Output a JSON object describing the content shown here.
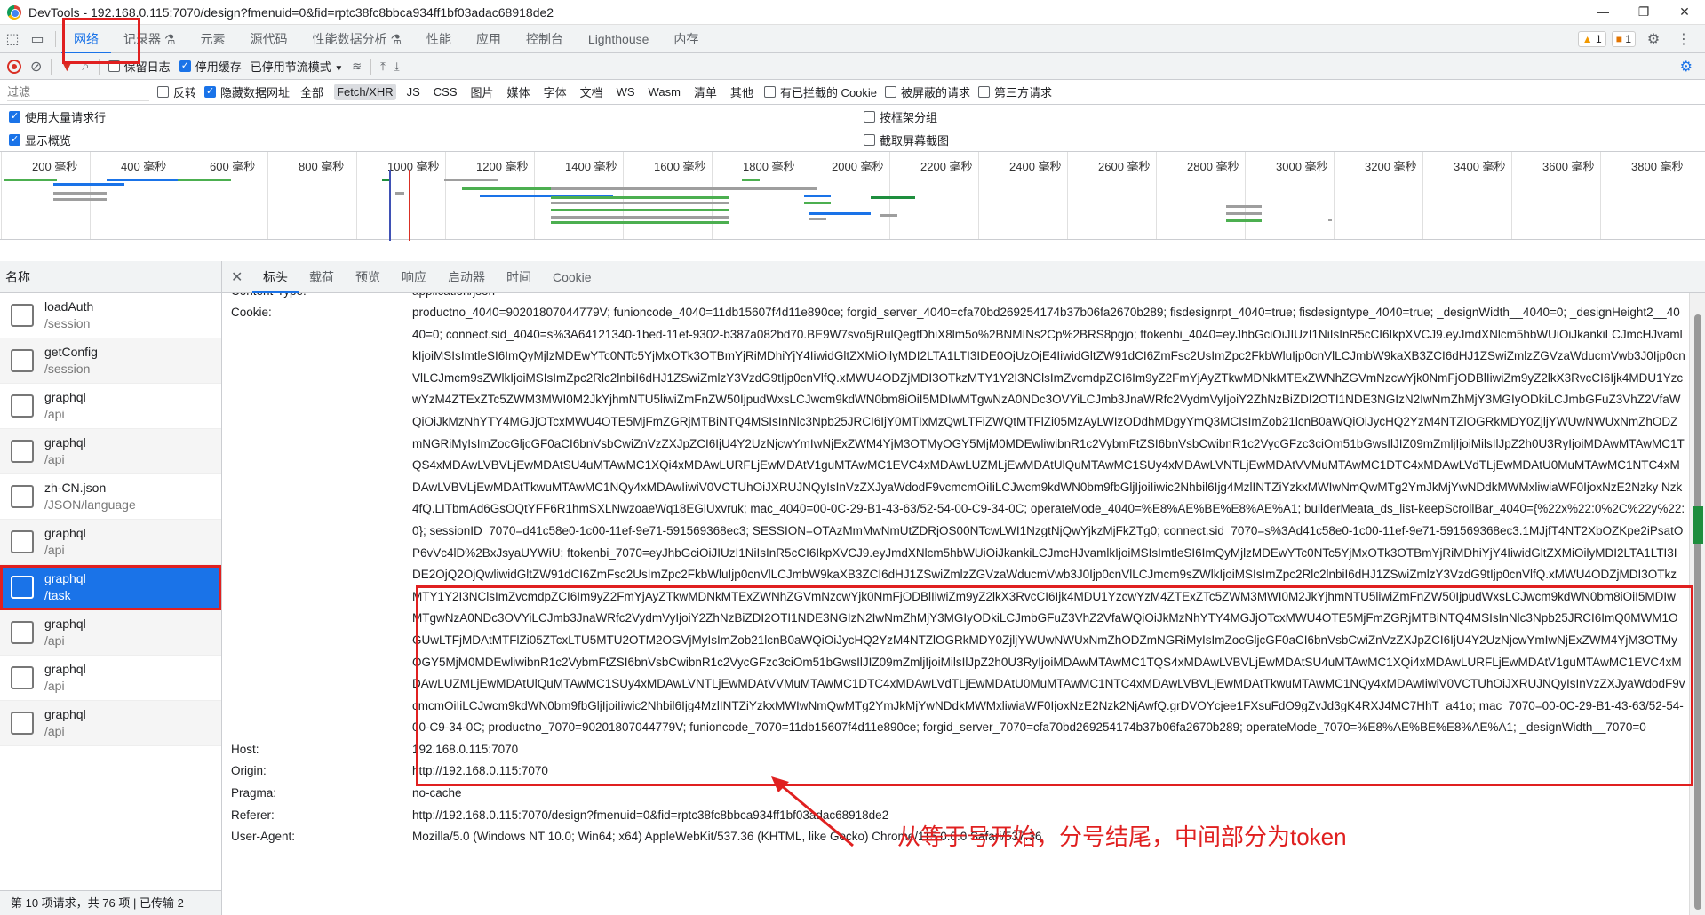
{
  "window": {
    "title": "DevTools - 192.168.0.115:7070/design?fmenuid=0&fid=rptc38fc8bbca934ff1bf03adac68918de2",
    "controls": [
      "—",
      "❐",
      "✕"
    ]
  },
  "tabs": [
    "网络",
    "记录器 ⚗",
    "元素",
    "源代码",
    "性能数据分析 ⚗",
    "性能",
    "应用",
    "控制台",
    "Lighthouse",
    "内存"
  ],
  "issues": {
    "warnings": "1",
    "info": "1"
  },
  "toolbar": {
    "preserve_log": "保留日志",
    "disable_cache": "停用缓存",
    "throttle": "已停用节流模式"
  },
  "filter": {
    "placeholder": "过滤",
    "invert": "反转",
    "hide_data_urls": "隐藏数据网址",
    "types": [
      "全部",
      "Fetch/XHR",
      "JS",
      "CSS",
      "图片",
      "媒体",
      "字体",
      "文档",
      "WS",
      "Wasm",
      "清单",
      "其他"
    ],
    "selected_type": "Fetch/XHR",
    "blocked_cookies": "有已拦截的 Cookie",
    "blocked_requests": "被屏蔽的请求",
    "third_party": "第三方请求"
  },
  "options": {
    "large_rows": "使用大量请求行",
    "group_by_frame": "按框架分组",
    "show_overview": "显示概览",
    "capture_screenshots": "截取屏幕截图"
  },
  "timeline": {
    "ticks": [
      "200 毫秒",
      "400 毫秒",
      "600 毫秒",
      "800 毫秒",
      "1000 毫秒",
      "1200 毫秒",
      "1400 毫秒",
      "1600 毫秒",
      "1800 毫秒",
      "2000 毫秒",
      "2200 毫秒",
      "2400 毫秒",
      "2600 毫秒",
      "2800 毫秒",
      "3000 毫秒",
      "3200 毫秒",
      "3400 毫秒",
      "3600 毫秒",
      "3800 毫秒"
    ]
  },
  "requests": {
    "header": "名称",
    "items": [
      {
        "name": "loadAuth",
        "path": "/session"
      },
      {
        "name": "getConfig",
        "path": "/session"
      },
      {
        "name": "graphql",
        "path": "/api"
      },
      {
        "name": "graphql",
        "path": "/api"
      },
      {
        "name": "zh-CN.json",
        "path": "/JSON/language"
      },
      {
        "name": "graphql",
        "path": "/api"
      },
      {
        "name": "graphql",
        "path": "/task"
      },
      {
        "name": "graphql",
        "path": "/api"
      },
      {
        "name": "graphql",
        "path": "/api"
      },
      {
        "name": "graphql",
        "path": "/api"
      }
    ],
    "selected_index": 6,
    "status": "第 10 项请求，共 76 项 | 已传输 2"
  },
  "detail": {
    "tabs": [
      "标头",
      "载荷",
      "预览",
      "响应",
      "启动器",
      "时间",
      "Cookie"
    ],
    "active_tab": "标头",
    "cut_key": "Content-Type:",
    "cut_value": "application/json",
    "cookie_key": "Cookie:",
    "cookie_part1": "productno_4040=90201807044779V; funioncode_4040=11db15607f4d11e890ce; forgid_server_4040=cfa70bd269254174b37b06fa2670b289; fisdesignrpt_4040=true; fisdesigntype_4040=true; _designWidth__4040=0; _designHeight2__4040=0; connect.sid_4040=s%3A64121340-1bed-11ef-9302-b387a082bd70.BE9W7svo5jRulQegfDhiX8lm5o%2BNMINs2Cp%2BRS8pgjo; ftokenbi_4040=eyJhbGciOiJIUzI1NiIsInR5cCI6IkpXVCJ9.eyJmdXNlcm5hbWUiOiJkankiLCJmcHJvamlkIjoiMSIsImtleSI6ImQyMjlzMDEwYTc0NTc5YjMxOTk3OTBmYjRiMDhiYjY4IiwidGltZXMiOilyMDI2LTA1LTI3IDE0OjUzOjE4IiwidGltZW91dCI6ZmFsc2UsImZpc2FkbWluIjp0cnVlLCJmbW9kaXB3ZCI6dHJ1ZSwiZmlzZGVzaWducmVwb3J0Ijp0cnVlLCJmcm9sZWlkIjoiMSIsImZpc2Rlc2lnbiI6dHJ1ZSwiZmlzY3VzdG9tIjp0cnVlfQ.xMWU4ODZjMDI3OTkzMTY1Y2I3NClsImZvcmdpZCI6Im9yZ2FmYjAyZTkwMDNkMTExZWNhZGVmNzcwYjk0NmFjODBlIiwiZm9yZ2lkX3RvcCI6Ijk4MDU1YzcwYzM4ZTExZTc5ZWM3MWI0M2JkYjhmNTU5liwiZmFnZW50IjpudWxsLCJwcm9kdWN0bm8iOiI5MDIwMTgwNzA0NDc3OVYiLCJmb3JnaWRfc2VydmVyIjoiY2ZhNzBiZDI2OTI1NDE3NGIzN2IwNmZhMjY3MGIyODkiLCJmbGFuZ3VhZ2VfaWQiOiJkMzNhYTY4MGJjOTcxMWU4OTE5MjFmZGRjMTBiNTQ4MSIsInNlc3Npb25JRCI6IjY0MTIxMzQwLTFiZWQtMTFlZi05MzAyLWIzODdhMDgyYmQ3MCIsImZob21lcnB0aWQiOiJycHQ2YzM4NTZlOGRkMDY0ZjljYWUwNWUxNmZhODZmNGRiMyIsImZocGljcGF0aCI6bnVsbCwiZnVzZXJpZCI6IjU4Y2UzNjcwYmIwNjExZWM4YjM3OTMyOGY5MjM0MDEwliwibnR1c2VybmFtZSI6bnVsbCwibnR1c2VycGFzc3ciOm51bGwsIlJIZ09mZmljIjoiMilsIlJpZ2h0U3RyIjoiMDAwMTAwMC1TQS4xMDAwLVBVLjEwMDAtSU4uMTAwMC1XQi4xMDAwLURFLjEwMDAtV1guMTAwMC1EVC4xMDAwLUZMLjEwMDAtUlQuMTAwMC1SUy4xMDAwLVNTLjEwMDAtVVMuMTAwMC1DTC4xMDAwLVdTLjEwMDAtU0MuMTAwMC1NTC4xMDAwLVBVLjEwMDAtTkwuMTAwMC1NQy4xMDAwIiwiV0VCTUhOiJXRUJNQyIsInVzZXJyaWdodF9vcmcmOiIiLCJwcm9kdWN0bm9fbGljIjoiIiwic2Nhbil6Ijg4MzlINTZiYzkxMWIwNmQwMTg2YmJkMjYwNDdkMWMxliwiaWF0IjoxNzE2Nzky Nzk4fQ.LITbmAd6GsOQtYFF6R1hmSXLNwzoaeWq18EGlUxvruk; mac_4040=00-0C-29-B1-43-63/52-54-00-C9-34-0C; operateMode_4040=%E8%AE%BE%E8%AE%A1; builderMeata_ds_list-keepScrollBar_4040={%22x%22:0%2C%22y%22:0}; sessionID_7070=d41c58e0-1c00-11ef-9e71-591569368ec3; SESSION=OTAzMmMwNmUtZDRjOS00NTcwLWI1NzgtNjQwYjkzMjFkZTg0; connect.sid_7070=s%3Ad41c58e0-1c00-11ef-9e71-591569368ec3.1MJjfT4NT2XbOZKpe2iPsatOP6vVc4lD%2BxJsyaUYWiU;",
    "cookie_token": "ftokenbi_7070=eyJhbGciOiJIUzI1NiIsInR5cCI6IkpXVCJ9.eyJmdXNlcm5hbWUiOiJkankiLCJmcHJvamlkIjoiMSIsImtleSI6ImQyMjlzMDEwYTc0NTc5YjMxOTk3OTBmYjRiMDhiYjY4IiwidGltZXMiOilyMDI2LTA1LTI3IDE2OjQ2OjQwliwidGltZW91dCI6ZmFsc2UsImZpc2FkbWluIjp0cnVlLCJmbW9kaXB3ZCI6dHJ1ZSwiZmlzZGVzaWducmVwb3J0Ijp0cnVlLCJmcm9sZWlkIjoiMSIsImZpc2Rlc2lnbiI6dHJ1ZSwiZmlzY3VzdG9tIjp0cnVlfQ.xMWU4ODZjMDI3OTkzMTY1Y2I3NClsImZvcmdpZCI6Im9yZ2FmYjAyZTkwMDNkMTExZWNhZGVmNzcwYjk0NmFjODBlIiwiZm9yZ2lkX3RvcCI6Ijk4MDU1YzcwYzM4ZTExZTc5ZWM3MWI0M2JkYjhmNTU5liwiZmFnZW50IjpudWxsLCJwcm9kdWN0bm8iOiI5MDIwMTgwNzA0NDc3OVYiLCJmb3JnaWRfc2VydmVyIjoiY2ZhNzBiZDI2OTI1NDE3NGIzN2IwNmZhMjY3MGIyODkiLCJmbGFuZ3VhZ2VfaWQiOiJkMzNhYTY4MGJjOTcxMWU4OTE5MjFmZGRjMTBiNTQ4MSIsInNlc3Npb25JRCI6ImQ0MWM1OGUwLTFjMDAtMTFlZi05ZTcxLTU5MTU2OTM2OGVjMyIsImZob21lcnB0aWQiOiJycHQ2YzM4NTZlOGRkMDY0ZjljYWUwNWUxNmZhODZmNGRiMyIsImZocGljcGF0aCI6bnVsbCwiZnVzZXJpZCI6IjU4Y2UzNjcwYmIwNjExZWM4YjM3OTMyOGY5MjM0MDEwliwibnR1c2VybmFtZSI6bnVsbCwibnR1c2VycGFzc3ciOm51bGwsIlJIZ09mZmljIjoiMilsIlJpZ2h0U3RyIjoiMDAwMTAwMC1TQS4xMDAwLVBVLjEwMDAtSU4uMTAwMC1XQi4xMDAwLURFLjEwMDAtV1guMTAwMC1EVC4xMDAwLUZMLjEwMDAtUlQuMTAwMC1SUy4xMDAwLVNTLjEwMDAtVVMuMTAwMC1DTC4xMDAwLVdTLjEwMDAtU0MuMTAwMC1NTC4xMDAwLVBVLjEwMDAtTkwuMTAwMC1NQy4xMDAwIiwiV0VCTUhOiJXRUJNQyIsInVzZXJyaWdodF9vcmcmOiIiLCJwcm9kdWN0bm9fbGljIjoiIiwic2Nhbil6Ijg4MzlINTZiYzkxMWIwNmQwMTg2YmJkMjYwNDdkMWMxliwiaWF0IjoxNzE2Nzk2NjAwfQ.grDVOYcjee1FXsuFdO9gZvJd3gK4RXJ4MC7HhT_a41o; mac_7070=00-0C-29-B1-43-63/52-54-00-C9-34-0C; productno_7070=90201807044779V; funioncode_7070=11db15607f4d11e890ce;",
    "cookie_part3": "forgid_server_7070=cfa70bd269254174b37b06fa2670b289; operateMode_7070=%E8%AE%BE%E8%AE%A1; _designWidth__7070=0",
    "headers": [
      {
        "key": "Host:",
        "value": "192.168.0.115:7070"
      },
      {
        "key": "Origin:",
        "value": "http://192.168.0.115:7070"
      },
      {
        "key": "Pragma:",
        "value": "no-cache"
      },
      {
        "key": "Referer:",
        "value": "http://192.168.0.115:7070/design?fmenuid=0&fid=rptc38fc8bbca934ff1bf03adac68918de2"
      },
      {
        "key": "User-Agent:",
        "value": "Mozilla/5.0 (Windows NT 10.0; Win64; x64) AppleWebKit/537.36 (KHTML, like Gecko) Chrome/115.0.0.0 Safari/537.36"
      }
    ]
  },
  "annotation": {
    "text": "从等于号开始，分号结尾，中间部分为token",
    "color": "#e02020"
  },
  "colors": {
    "accent": "#1a73e8",
    "annotation": "#e02020"
  }
}
